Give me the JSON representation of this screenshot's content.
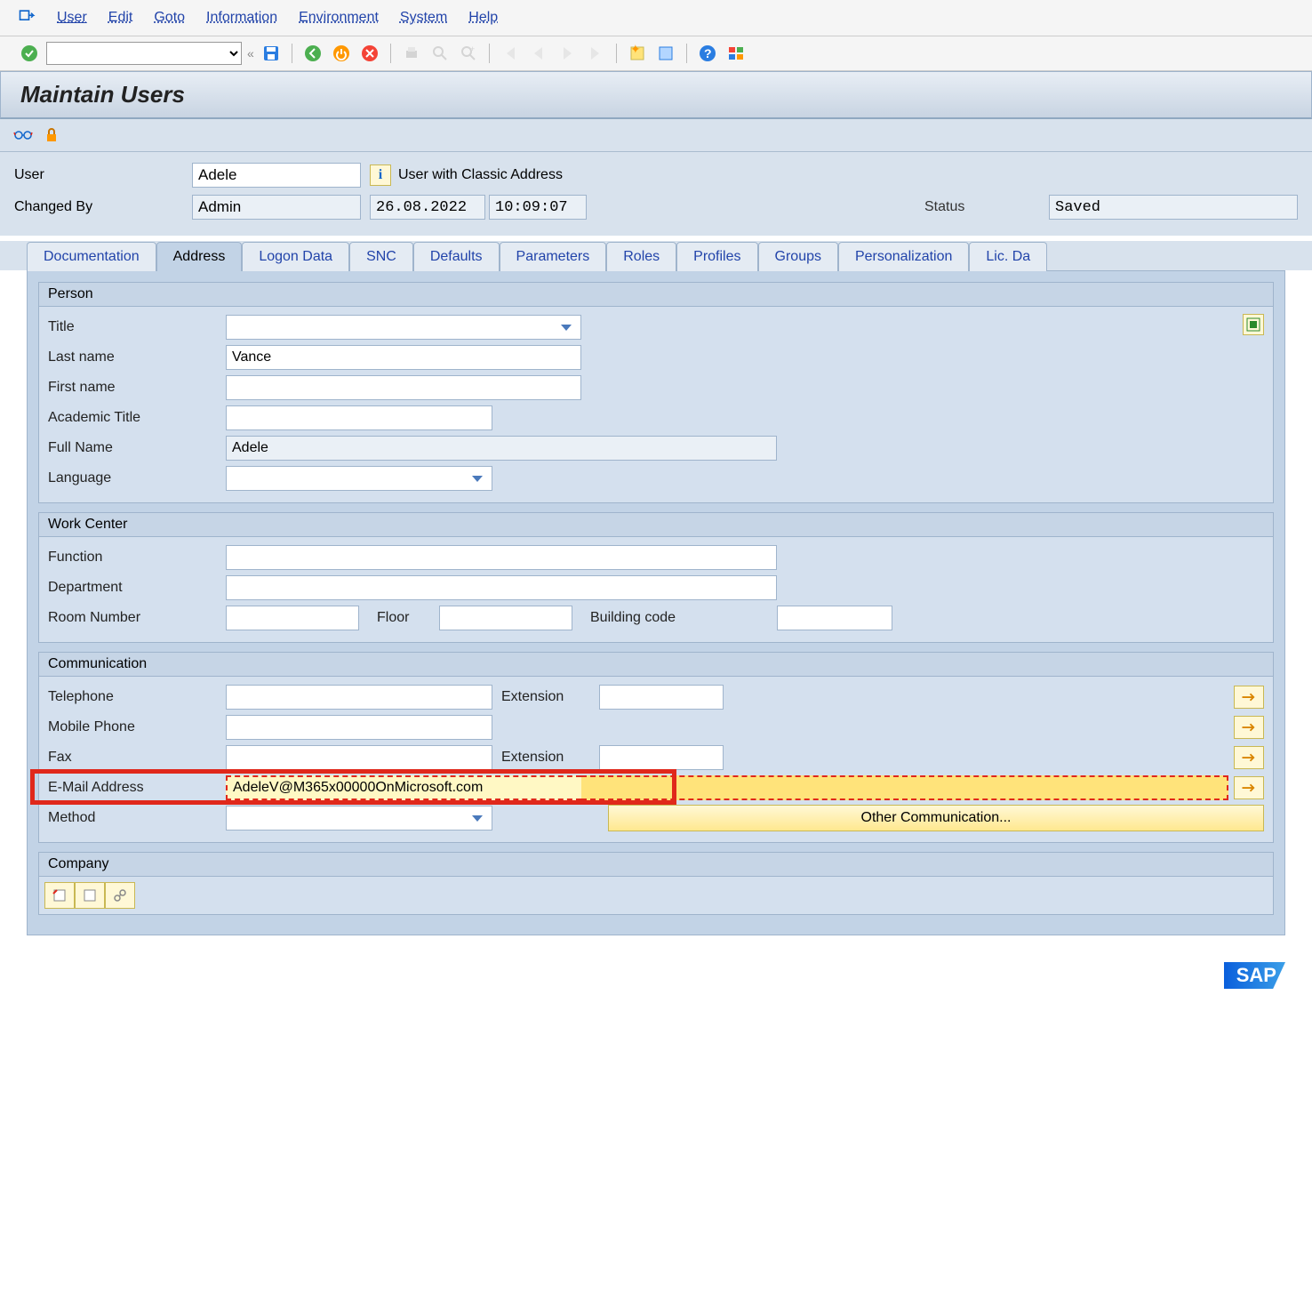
{
  "menu": {
    "user": "User",
    "edit": "Edit",
    "goto": "Goto",
    "information": "Information",
    "environment": "Environment",
    "system": "System",
    "help": "Help"
  },
  "title": "Maintain Users",
  "header": {
    "user_label": "User",
    "user": "Adele",
    "info_text": "User with Classic Address",
    "changedby_label": "Changed By",
    "changedby": "Admin",
    "date": "26.08.2022",
    "time": "10:09:07",
    "status_label": "Status",
    "status": "Saved"
  },
  "tabs": {
    "documentation": "Documentation",
    "address": "Address",
    "logon": "Logon Data",
    "snc": "SNC",
    "defaults": "Defaults",
    "parameters": "Parameters",
    "roles": "Roles",
    "profiles": "Profiles",
    "groups": "Groups",
    "personalization": "Personalization",
    "lic": "Lic. Da"
  },
  "person": {
    "group": "Person",
    "title_label": "Title",
    "title": "",
    "lastname_label": "Last name",
    "lastname": "Vance",
    "firstname_label": "First name",
    "firstname": "",
    "academic_label": "Academic Title",
    "academic": "",
    "fullname_label": "Full Name",
    "fullname": "Adele",
    "language_label": "Language",
    "language": ""
  },
  "work": {
    "group": "Work Center",
    "function_label": "Function",
    "function": "",
    "department_label": "Department",
    "department": "",
    "room_label": "Room Number",
    "room": "",
    "floor_label": "Floor",
    "floor": "",
    "building_label": "Building code",
    "building": ""
  },
  "comm": {
    "group": "Communication",
    "telephone_label": "Telephone",
    "telephone": "",
    "ext_label": "Extension",
    "telephone_ext": "",
    "mobile_label": "Mobile Phone",
    "mobile": "",
    "fax_label": "Fax",
    "fax": "",
    "fax_ext": "",
    "email_label": "E-Mail Address",
    "email": "AdeleV@M365x00000OnMicrosoft.com",
    "method_label": "Method",
    "method": "",
    "other_btn": "Other Communication..."
  },
  "company": {
    "group": "Company"
  },
  "footer_logo": "SAP"
}
